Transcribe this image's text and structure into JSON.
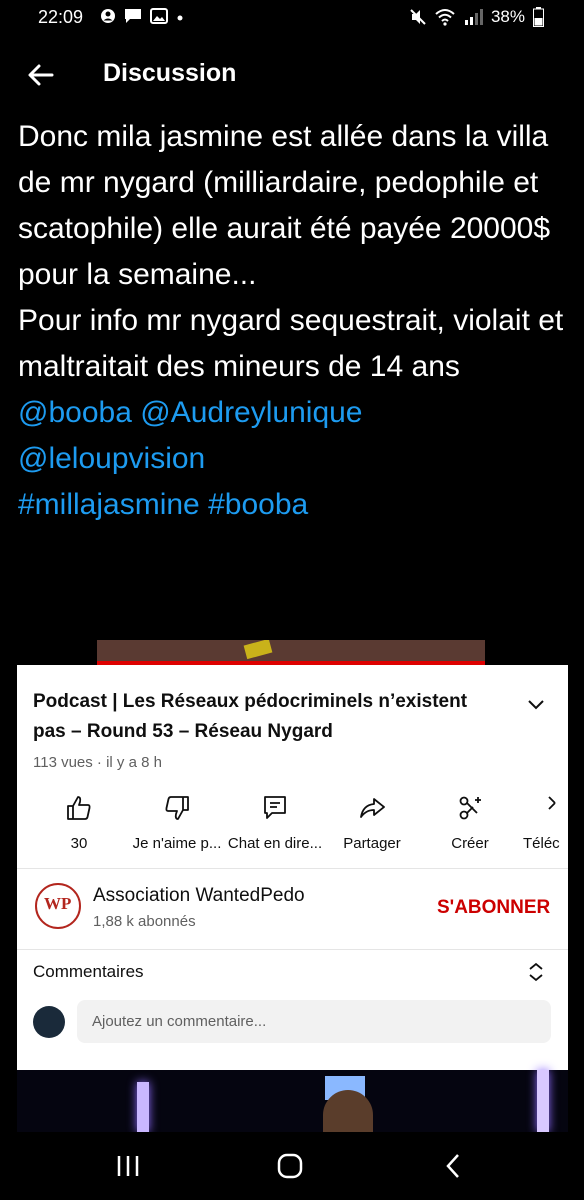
{
  "status_bar": {
    "time": "22:09",
    "battery": "38%",
    "icons_left": [
      "profile-icon",
      "message-icon",
      "image-icon",
      "dot-icon"
    ],
    "icons_right": [
      "mute-icon",
      "wifi-icon",
      "signal-icon",
      "battery-icon"
    ]
  },
  "header": {
    "title": "Discussion"
  },
  "tweet": {
    "paragraph1": "Donc mila jasmine est allée dans la villa de mr nygard (milliardaire, pedophile et scatophile) elle aurait été payée 20000$ pour la semaine...",
    "paragraph2": "Pour info mr nygard sequestrait, violait et maltraitait des mineurs de 14 ans",
    "mentions": [
      "@booba",
      "@Audreylunique",
      "@leloupvision"
    ],
    "hashtags": [
      "#millajasmine",
      "#booba"
    ],
    "link_color": "#1d9bf0"
  },
  "video": {
    "title": "Podcast | Les Réseaux pédocriminels n’existent pas – Round 53 – Réseau Nygard",
    "meta": "113 vues · il y a 8 h",
    "actions": [
      {
        "icon": "like-icon",
        "label": "30"
      },
      {
        "icon": "dislike-icon",
        "label": "Je n'aime p..."
      },
      {
        "icon": "chat-icon",
        "label": "Chat en dire..."
      },
      {
        "icon": "share-icon",
        "label": "Partager"
      },
      {
        "icon": "create-icon",
        "label": "Créer"
      },
      {
        "icon": "download-icon",
        "label": "Téléc"
      }
    ],
    "channel": {
      "name": "Association WantedPedo",
      "subscribers": "1,88 k abonnés",
      "subscribe_label": "S'ABONNER",
      "subscribe_color": "#cc0000"
    },
    "comments": {
      "title": "Commentaires",
      "placeholder": "Ajoutez un commentaire..."
    }
  },
  "nav": {
    "icons": [
      "recents-icon",
      "home-icon",
      "back-icon"
    ]
  }
}
